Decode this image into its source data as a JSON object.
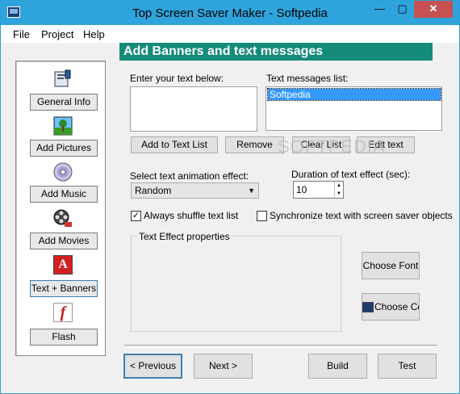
{
  "window": {
    "title": "Top Screen Saver Maker - Softpedia",
    "minimize": "—",
    "maximize": "▢",
    "close": "✕"
  },
  "menu": [
    "File",
    "Project",
    "Help"
  ],
  "sidebar": {
    "items": [
      {
        "label": "General Info",
        "icon": "settings-icon"
      },
      {
        "label": "Add Pictures",
        "icon": "picture-icon"
      },
      {
        "label": "Add Music",
        "icon": "cd-icon"
      },
      {
        "label": "Add Movies",
        "icon": "film-reel-icon"
      },
      {
        "label": "Text + Banners",
        "icon": "text-a-icon",
        "icon_glyph": "A"
      },
      {
        "label": "Flash",
        "icon": "flash-icon",
        "icon_glyph": "f"
      }
    ]
  },
  "panel": {
    "header": "Add Banners and text messages",
    "enter_text_label": "Enter your text below:",
    "enter_text_value": "",
    "messages_label": "Text messages list:",
    "messages": [
      "Softpedia"
    ],
    "buttons": {
      "add": "Add to Text List",
      "remove": "Remove",
      "clear": "Clear List",
      "edit": "Edit text"
    },
    "animation_label": "Select text animation effect:",
    "animation_value": "Random",
    "duration_label": "Duration of text effect (sec):",
    "duration_value": "10",
    "shuffle_label": "Always shuffle text list",
    "shuffle_checked": true,
    "sync_label": "Synchronize text with screen saver objects",
    "sync_checked": false,
    "effect_group_label": "Text Effect properties",
    "choose_font": "Choose Font",
    "choose_color": "Choose Colo"
  },
  "footer": {
    "previous": "< Previous",
    "next": "Next >",
    "build": "Build",
    "test": "Test"
  },
  "watermark": "SOFTPEDIA",
  "colors": {
    "titlebar": "#2fa3dc",
    "header": "#158b7a",
    "selection": "#3399ff",
    "close": "#c75050"
  }
}
